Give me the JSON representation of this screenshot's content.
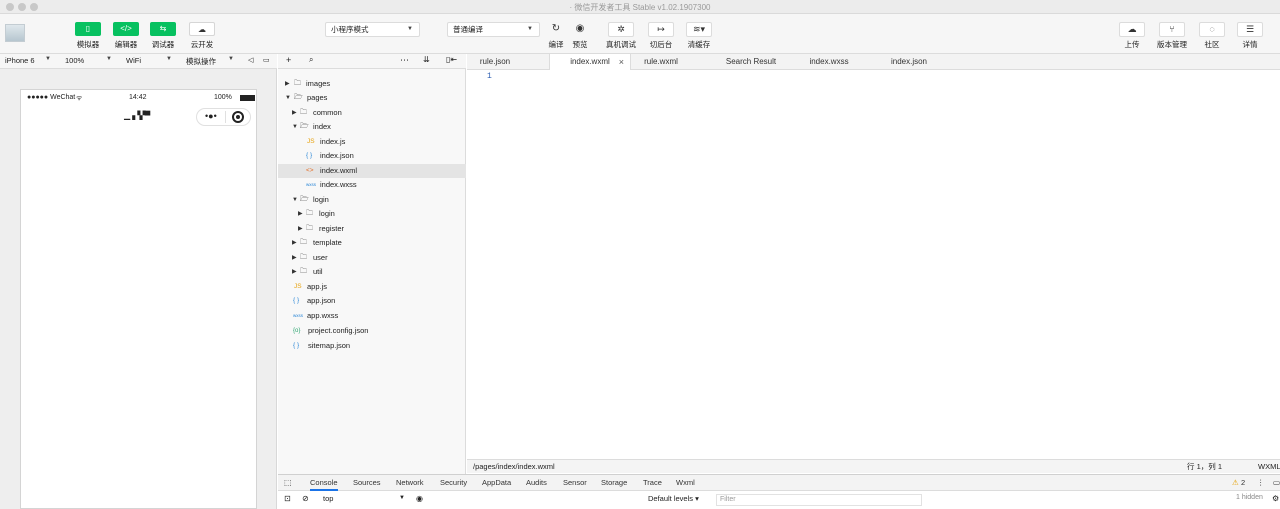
{
  "window": {
    "title": "· 微信开发者工具 Stable v1.02.1907300"
  },
  "toolbar": {
    "simulator": {
      "label": "模拟器",
      "icon": "phone-icon"
    },
    "editor": {
      "label": "编辑器",
      "icon": "code-icon"
    },
    "debugger": {
      "label": "调试器",
      "icon": "debug-icon"
    },
    "cloud": {
      "label": "云开发",
      "icon": "cloud-icon"
    },
    "mode_select": "小程序模式",
    "compile_select": "普通编译",
    "compile": {
      "label": "编译",
      "icon": "refresh-icon"
    },
    "preview": {
      "label": "预览",
      "icon": "eye-icon"
    },
    "remote_debug": {
      "label": "真机调试",
      "icon": "bug-icon"
    },
    "backend": {
      "label": "切后台",
      "icon": "switch-icon"
    },
    "clear_cache": {
      "label": "清缓存",
      "icon": "layers-icon"
    },
    "upload": {
      "label": "上传",
      "icon": "upload-icon"
    },
    "version": {
      "label": "版本管理",
      "icon": "branch-icon"
    },
    "community": {
      "label": "社区",
      "icon": "chat-icon"
    },
    "details": {
      "label": "详情",
      "icon": "menu-icon"
    }
  },
  "device_bar": {
    "device": "iPhone 6",
    "zoom": "100%",
    "network": "WiFi",
    "operation": "模拟操作"
  },
  "phone": {
    "carrier": "●●●●● WeChat",
    "wifi": "ᯤ",
    "time": "14:42",
    "battery": "100%"
  },
  "explorer": {
    "nodes": [
      {
        "label": "images",
        "toggle": "▶",
        "icon": "folder"
      },
      {
        "label": "pages",
        "toggle": "▼",
        "icon": "folder-open"
      },
      {
        "label": "common",
        "toggle": "▶",
        "icon": "folder"
      },
      {
        "label": "index",
        "toggle": "▼",
        "icon": "folder-open"
      },
      {
        "label": "index.js",
        "toggle": "",
        "icon": "JS"
      },
      {
        "label": "index.json",
        "toggle": "",
        "icon": "{ }"
      },
      {
        "label": "index.wxml",
        "toggle": "",
        "icon": "<>"
      },
      {
        "label": "index.wxss",
        "toggle": "",
        "icon": "wxss"
      },
      {
        "label": "login",
        "toggle": "▼",
        "icon": "folder-open"
      },
      {
        "label": "login",
        "toggle": "▶",
        "icon": "folder"
      },
      {
        "label": "register",
        "toggle": "▶",
        "icon": "folder"
      },
      {
        "label": "template",
        "toggle": "▶",
        "icon": "folder"
      },
      {
        "label": "user",
        "toggle": "▶",
        "icon": "folder"
      },
      {
        "label": "util",
        "toggle": "▶",
        "icon": "folder"
      },
      {
        "label": "app.js",
        "toggle": "",
        "icon": "JS"
      },
      {
        "label": "app.json",
        "toggle": "",
        "icon": "{ }"
      },
      {
        "label": "app.wxss",
        "toggle": "",
        "icon": "wxss"
      },
      {
        "label": "project.config.json",
        "toggle": "",
        "icon": "{o}"
      },
      {
        "label": "sitemap.json",
        "toggle": "",
        "icon": "{ }"
      }
    ]
  },
  "editor_tabs": [
    {
      "label": "rule.json"
    },
    {
      "label": "index.wxml"
    },
    {
      "label": "rule.wxml"
    },
    {
      "label": "Search Result"
    },
    {
      "label": "index.wxss"
    },
    {
      "label": "index.json"
    }
  ],
  "editor": {
    "line_number": "1"
  },
  "status_bar": {
    "path": "/pages/index/index.wxml",
    "position": "行 1，列 1",
    "language": "WXML"
  },
  "console": {
    "tabs": [
      "Console",
      "Sources",
      "Network",
      "Security",
      "AppData",
      "Audits",
      "Sensor",
      "Storage",
      "Trace",
      "Wxml"
    ],
    "warnings": "2",
    "context": "top",
    "filter_placeholder": "Filter",
    "levels": "Default levels ▾",
    "hidden": "1 hidden"
  },
  "colors": {
    "accent": "#07c160",
    "selected": "#1a73e8"
  }
}
